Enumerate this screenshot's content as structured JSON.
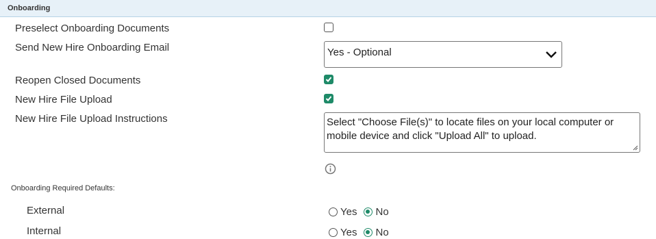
{
  "section": {
    "title": "Onboarding"
  },
  "fields": {
    "preselect": {
      "label": "Preselect Onboarding Documents",
      "checked": false
    },
    "send_email": {
      "label": "Send New Hire Onboarding Email",
      "value": "Yes - Optional"
    },
    "reopen": {
      "label": "Reopen Closed Documents",
      "checked": true
    },
    "file_upload": {
      "label": "New Hire File Upload",
      "checked": true
    },
    "instructions": {
      "label": "New Hire File Upload Instructions",
      "value": "Select \"Choose File(s)\" to locate files on your local computer or mobile device and click \"Upload All\" to upload."
    }
  },
  "required_defaults": {
    "title": "Onboarding Required Defaults:",
    "rows": [
      {
        "label": "External",
        "yes_label": "Yes",
        "no_label": "No",
        "selected": "No"
      },
      {
        "label": "Internal",
        "yes_label": "Yes",
        "no_label": "No",
        "selected": "No"
      }
    ]
  },
  "icons": {
    "info": "info-circle-icon",
    "chevron": "chevron-down-icon",
    "check": "check-icon"
  },
  "colors": {
    "accent": "#1e8a68",
    "header_bg": "#e7f1f8"
  }
}
